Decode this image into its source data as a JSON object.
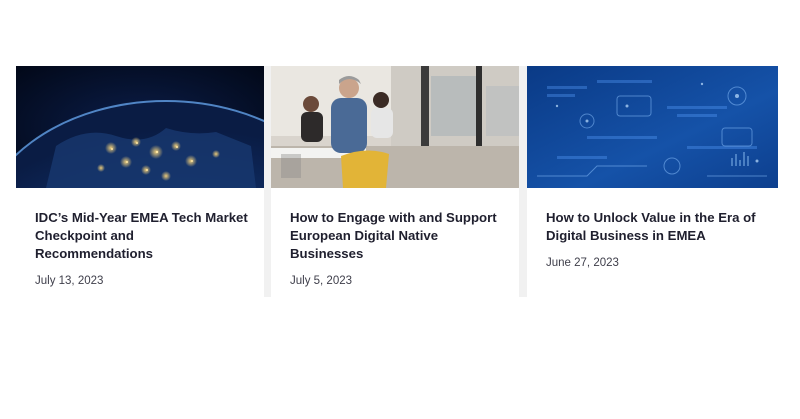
{
  "cards": [
    {
      "title": "IDC’s Mid-Year EMEA Tech Market Checkpoint and Recommendations",
      "date": "July 13, 2023",
      "image": "earth-at-night-europe"
    },
    {
      "title": "How to Engage with and Support European Digital Native Businesses",
      "date": "July 5, 2023",
      "image": "office-meeting-people"
    },
    {
      "title": "How to Unlock Value in the Era of Digital Business in EMEA",
      "date": "June 27, 2023",
      "image": "digital-blue-interface"
    }
  ],
  "colors": {
    "title": "#1f1f2e",
    "date": "#3e3e4a",
    "background": "#f1f1f1",
    "accent_blue": "#1c4f9c"
  }
}
